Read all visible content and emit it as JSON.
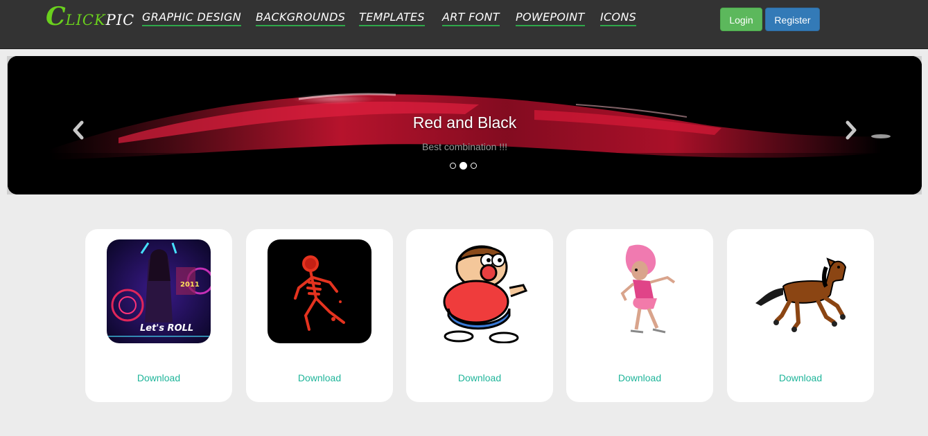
{
  "brand": {
    "c": "C",
    "lick": "LICK",
    "pic": "PIC"
  },
  "nav": {
    "items": [
      "GRAPHIC DESIGN",
      "BACKGROUNDS",
      "TEMPLATES",
      "ART FONT",
      "POWEPOINT",
      "ICONS"
    ]
  },
  "auth": {
    "login": "Login",
    "register": "Register"
  },
  "carousel": {
    "title": "Red and Black",
    "subtitle": "Best combination !!!",
    "slide_count": 3,
    "active_index": 1
  },
  "cards": [
    {
      "download": "Download",
      "thumb": "lets-roll-poster"
    },
    {
      "download": "Download",
      "thumb": "red-skeleton-dancer"
    },
    {
      "download": "Download",
      "thumb": "cartoon-big-nose-boy"
    },
    {
      "download": "Download",
      "thumb": "pink-hair-girl-skater"
    },
    {
      "download": "Download",
      "thumb": "brown-cartoon-horse"
    }
  ],
  "thumb_text": {
    "year": "2011",
    "lets_roll": "Let's ROLL"
  },
  "colors": {
    "navbar": "#333333",
    "brand_green": "#6ad01d",
    "underline_green": "#2ea84a",
    "login_green": "#5cb85c",
    "register_blue": "#337ab7",
    "download_teal": "#1fb59a",
    "page_bg": "#ececec"
  }
}
